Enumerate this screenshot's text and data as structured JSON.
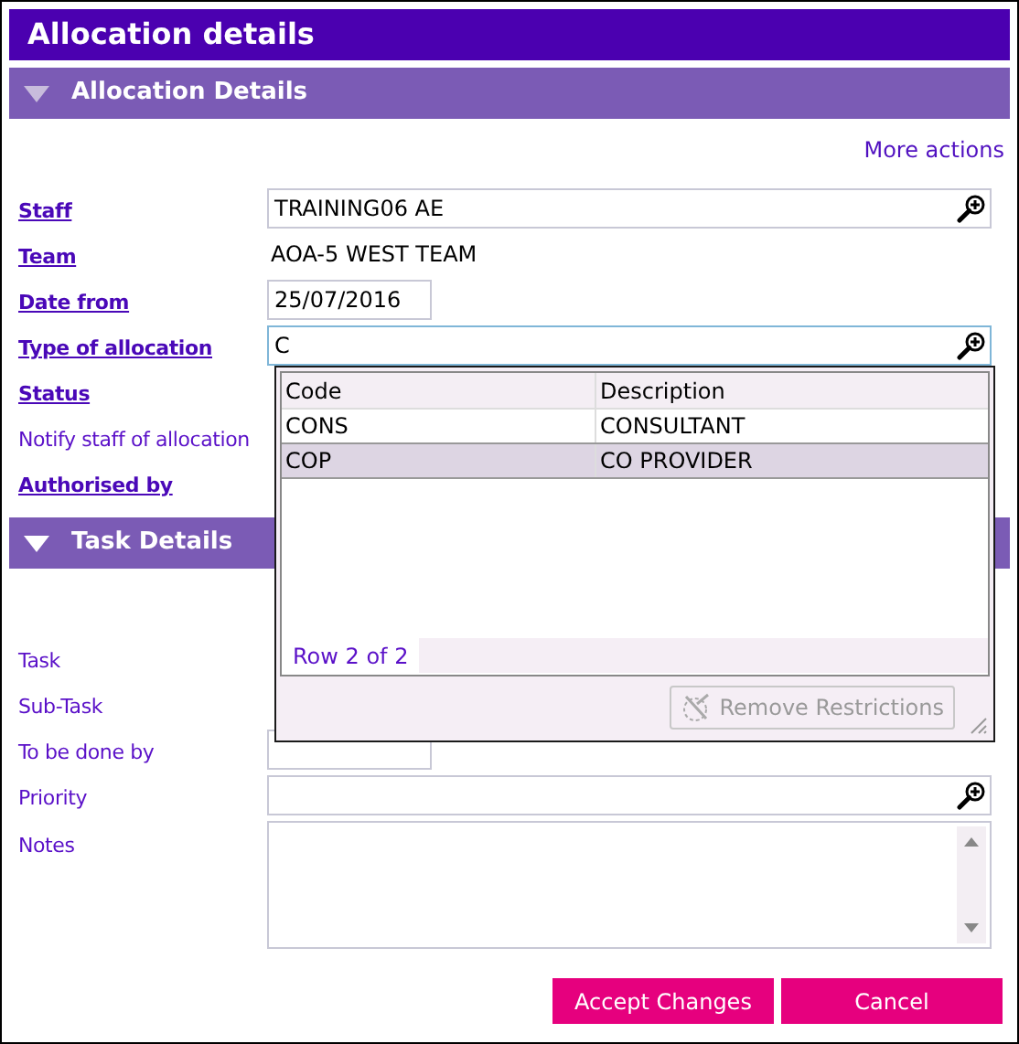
{
  "window": {
    "title": "Allocation details"
  },
  "sections": [
    {
      "title": "Allocation Details",
      "expanded": true,
      "hovered": true,
      "actions": [
        "More actions"
      ],
      "fields": [
        {
          "label": "Staff",
          "mandatory": true,
          "kind": "lookup",
          "value": "TRAINING06 AE"
        },
        {
          "label": "Team",
          "mandatory": true,
          "kind": "static",
          "value": "AOA-5 WEST TEAM"
        },
        {
          "label": "Date from",
          "mandatory": true,
          "kind": "date",
          "value": "25/07/2016"
        },
        {
          "label": "Type of allocation",
          "mandatory": true,
          "kind": "lookup",
          "value": "C",
          "focused": true
        },
        {
          "label": "Status",
          "mandatory": true,
          "kind": "hidden"
        },
        {
          "label": "Notify staff of allocation",
          "mandatory": false,
          "kind": "hidden"
        },
        {
          "label": "Authorised by",
          "mandatory": true,
          "kind": "hidden"
        }
      ]
    },
    {
      "title": "Task Details",
      "expanded": true,
      "hovered": false,
      "fields": [
        {
          "label": "Task",
          "mandatory": false,
          "kind": "hidden"
        },
        {
          "label": "Sub-Task",
          "mandatory": false,
          "kind": "hidden"
        },
        {
          "label": "To be done by",
          "mandatory": false,
          "kind": "date"
        },
        {
          "label": "Priority",
          "mandatory": false,
          "kind": "lookup"
        },
        {
          "label": "Notes",
          "mandatory": false,
          "kind": "textarea"
        }
      ]
    }
  ],
  "lookup_popup": {
    "columns": [
      "Code",
      "Description"
    ],
    "rows": [
      {
        "cells": [
          "CONS",
          "CONSULTANT"
        ],
        "selected": false
      },
      {
        "cells": [
          "COP",
          "CO PROVIDER"
        ],
        "selected": true
      }
    ],
    "footer": "Row 2 of 2",
    "button": {
      "label": "Remove Restrictions",
      "disabled": true
    }
  },
  "buttons": [
    "Accept Changes",
    "Cancel"
  ]
}
